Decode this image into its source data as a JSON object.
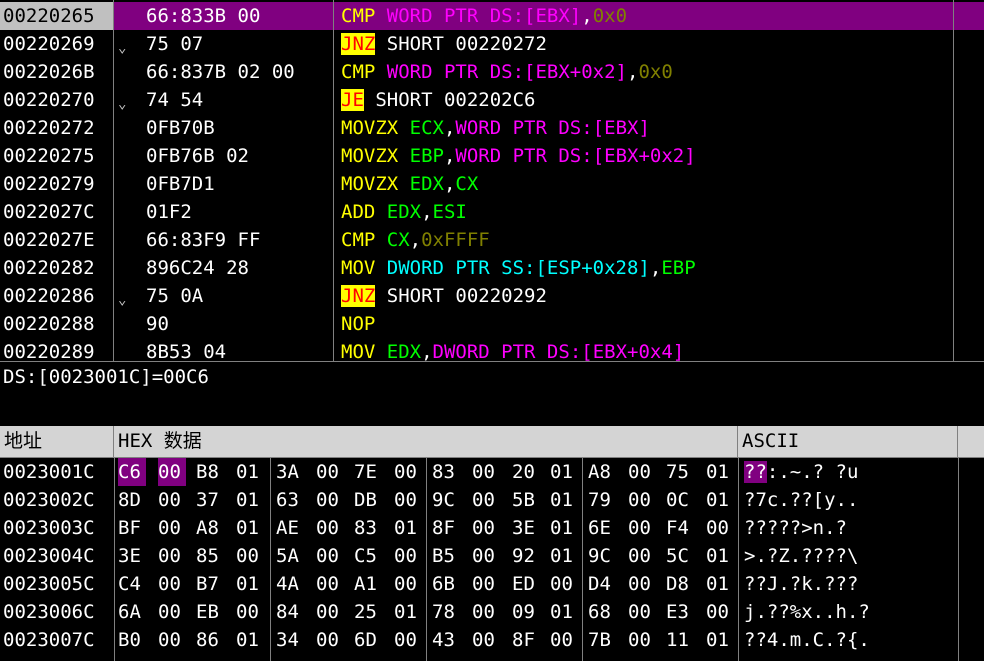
{
  "disasm": {
    "rows": [
      {
        "addr": "00220265",
        "jmp": "",
        "bytes": "66:833B 00",
        "instr": [
          [
            "m-cmp",
            "CMP "
          ],
          [
            "w-ptr",
            "WORD PTR DS:[EBX]"
          ],
          [
            "w-norm",
            ","
          ],
          [
            "w-num",
            "0x0"
          ]
        ]
      },
      {
        "addr": "00220269",
        "jmp": "⌄",
        "bytes": "75 07",
        "instr": [
          [
            "m-jcc",
            "JNZ"
          ],
          [
            "w-norm",
            " SHORT 00220272"
          ]
        ]
      },
      {
        "addr": "0022026B",
        "jmp": "",
        "bytes": "66:837B 02 00",
        "instr": [
          [
            "m-cmp",
            "CMP "
          ],
          [
            "w-ptr",
            "WORD PTR DS:[EBX+0x2]"
          ],
          [
            "w-norm",
            ","
          ],
          [
            "w-num",
            "0x0"
          ]
        ]
      },
      {
        "addr": "00220270",
        "jmp": "⌄",
        "bytes": "74 54",
        "instr": [
          [
            "m-jcc",
            "JE"
          ],
          [
            "w-norm",
            " SHORT 002202C6"
          ]
        ]
      },
      {
        "addr": "00220272",
        "jmp": "",
        "bytes": "0FB70B",
        "instr": [
          [
            "m-mov",
            "MOVZX "
          ],
          [
            "w-reg",
            "ECX"
          ],
          [
            "w-norm",
            ","
          ],
          [
            "w-ptr",
            "WORD PTR DS:[EBX]"
          ]
        ]
      },
      {
        "addr": "00220275",
        "jmp": "",
        "bytes": "0FB76B 02",
        "instr": [
          [
            "m-mov",
            "MOVZX "
          ],
          [
            "w-reg",
            "EBP"
          ],
          [
            "w-norm",
            ","
          ],
          [
            "w-ptr",
            "WORD PTR DS:[EBX+0x2]"
          ]
        ]
      },
      {
        "addr": "00220279",
        "jmp": "",
        "bytes": "0FB7D1",
        "instr": [
          [
            "m-mov",
            "MOVZX "
          ],
          [
            "w-reg",
            "EDX"
          ],
          [
            "w-norm",
            ","
          ],
          [
            "w-reg",
            "CX"
          ]
        ]
      },
      {
        "addr": "0022027C",
        "jmp": "",
        "bytes": "01F2",
        "instr": [
          [
            "m-add",
            "ADD "
          ],
          [
            "w-reg",
            "EDX"
          ],
          [
            "w-norm",
            ","
          ],
          [
            "w-reg",
            "ESI"
          ]
        ]
      },
      {
        "addr": "0022027E",
        "jmp": "",
        "bytes": "66:83F9 FF",
        "instr": [
          [
            "m-cmp",
            "CMP "
          ],
          [
            "w-reg",
            "CX"
          ],
          [
            "w-norm",
            ","
          ],
          [
            "w-num",
            "0xFFFF"
          ]
        ]
      },
      {
        "addr": "00220282",
        "jmp": "",
        "bytes": "896C24 28",
        "instr": [
          [
            "m-mov",
            "MOV "
          ],
          [
            "w-ss",
            "DWORD PTR SS:[ESP+0x28]"
          ],
          [
            "w-norm",
            ","
          ],
          [
            "w-reg",
            "EBP"
          ]
        ]
      },
      {
        "addr": "00220286",
        "jmp": "⌄",
        "bytes": "75 0A",
        "instr": [
          [
            "m-jcc",
            "JNZ"
          ],
          [
            "w-norm",
            " SHORT 00220292"
          ]
        ]
      },
      {
        "addr": "00220288",
        "jmp": "",
        "bytes": "90",
        "instr": [
          [
            "m-nop",
            "NOP"
          ]
        ]
      },
      {
        "addr": "00220289",
        "jmp": "",
        "bytes": "8B53 04",
        "instr": [
          [
            "m-mov",
            "MOV "
          ],
          [
            "w-reg",
            "EDX"
          ],
          [
            "w-norm",
            ","
          ],
          [
            "w-ptr",
            "DWORD PTR DS:[EBX+0x4]"
          ]
        ]
      }
    ]
  },
  "info": {
    "text": "DS:[0023001C]=00C6"
  },
  "dump": {
    "headers": {
      "addr": "地址",
      "hex": "HEX 数据",
      "ascii": "ASCII"
    },
    "rows": [
      {
        "addr": "0023001C",
        "bytes": [
          "C6",
          "00",
          "B8",
          "01",
          "3A",
          "00",
          "7E",
          "00",
          "83",
          "00",
          "20",
          "01",
          "A8",
          "00",
          "75",
          "01"
        ],
        "ascii": "??:.~.? ?u"
      },
      {
        "addr": "0023002C",
        "bytes": [
          "8D",
          "00",
          "37",
          "01",
          "63",
          "00",
          "DB",
          "00",
          "9C",
          "00",
          "5B",
          "01",
          "79",
          "00",
          "0C",
          "01"
        ],
        "ascii": "?7c.??[y.."
      },
      {
        "addr": "0023003C",
        "bytes": [
          "BF",
          "00",
          "A8",
          "01",
          "AE",
          "00",
          "83",
          "01",
          "8F",
          "00",
          "3E",
          "01",
          "6E",
          "00",
          "F4",
          "00"
        ],
        "ascii": "?????>n.?"
      },
      {
        "addr": "0023004C",
        "bytes": [
          "3E",
          "00",
          "85",
          "00",
          "5A",
          "00",
          "C5",
          "00",
          "B5",
          "00",
          "92",
          "01",
          "9C",
          "00",
          "5C",
          "01"
        ],
        "ascii": ">.?Z.????\\"
      },
      {
        "addr": "0023005C",
        "bytes": [
          "C4",
          "00",
          "B7",
          "01",
          "4A",
          "00",
          "A1",
          "00",
          "6B",
          "00",
          "ED",
          "00",
          "D4",
          "00",
          "D8",
          "01"
        ],
        "ascii": "??J.?k.???"
      },
      {
        "addr": "0023006C",
        "bytes": [
          "6A",
          "00",
          "EB",
          "00",
          "84",
          "00",
          "25",
          "01",
          "78",
          "00",
          "09",
          "01",
          "68",
          "00",
          "E3",
          "00"
        ],
        "ascii": "j.??%x..h.?"
      },
      {
        "addr": "0023007C",
        "bytes": [
          "B0",
          "00",
          "86",
          "01",
          "34",
          "00",
          "6D",
          "00",
          "43",
          "00",
          "8F",
          "00",
          "7B",
          "00",
          "11",
          "01"
        ],
        "ascii": "??4.m.C.?{."
      }
    ]
  }
}
